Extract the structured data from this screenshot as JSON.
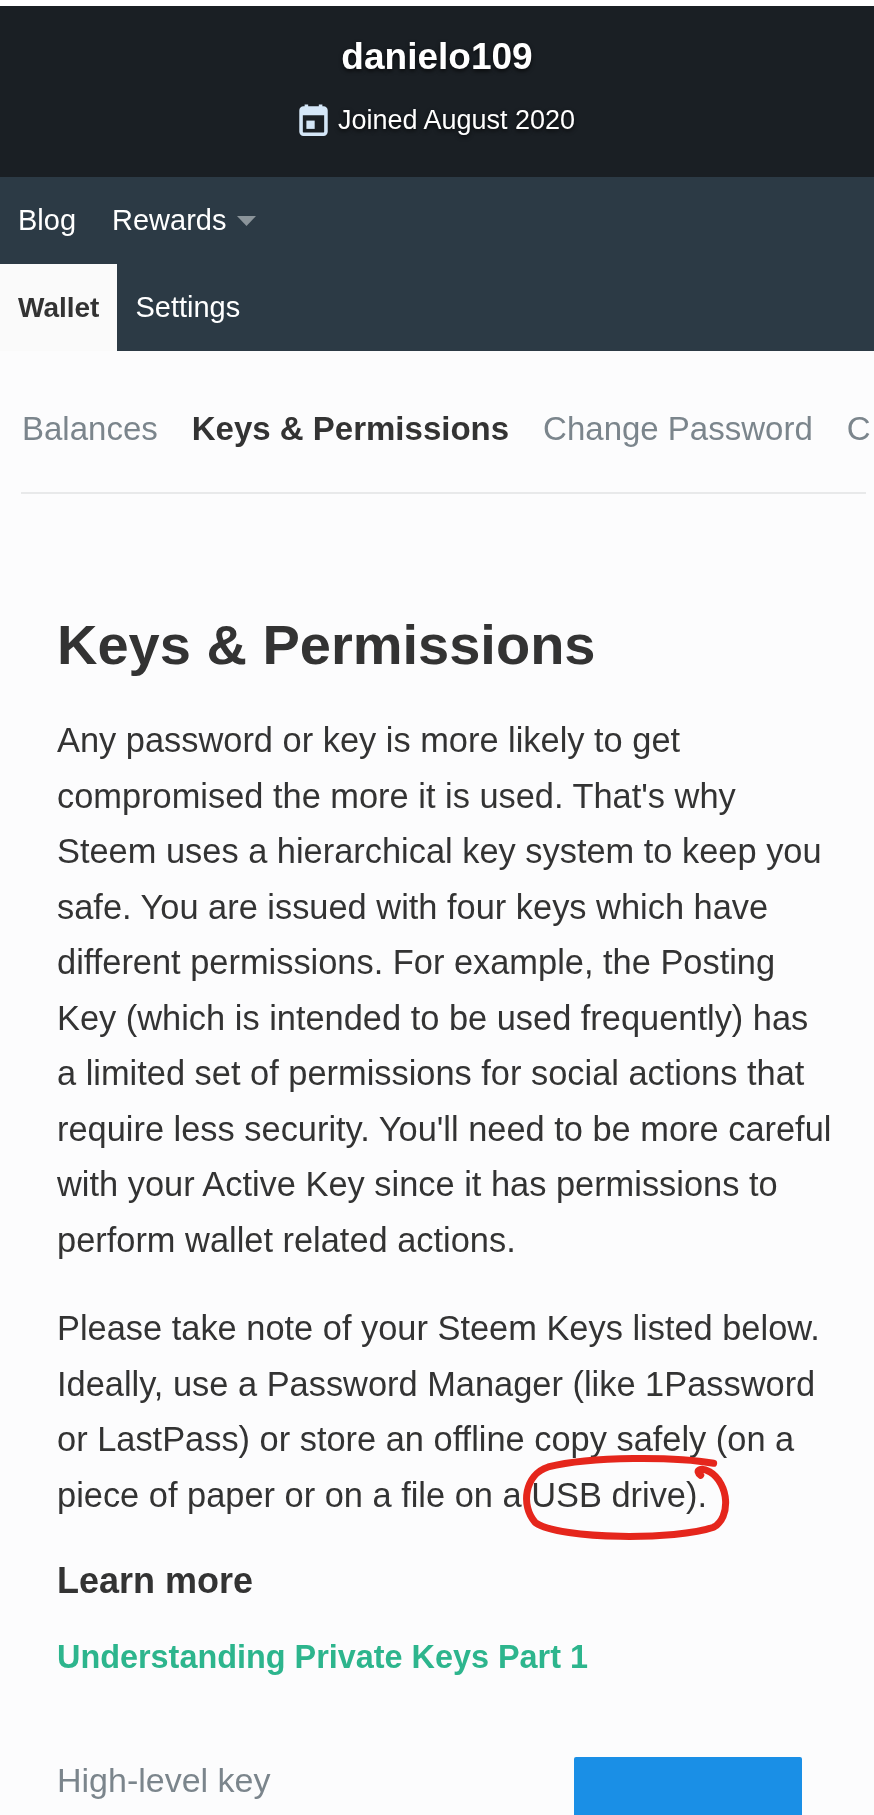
{
  "profile": {
    "username": "danielo109",
    "joined": "Joined August 2020"
  },
  "main_nav": [
    {
      "items": [
        {
          "label": "Blog",
          "selected": false,
          "dropdown": false
        },
        {
          "label": "Rewards",
          "selected": false,
          "dropdown": true
        }
      ]
    },
    {
      "items": [
        {
          "label": "Wallet",
          "selected": true,
          "dropdown": false
        },
        {
          "label": "Settings",
          "selected": false,
          "dropdown": false
        }
      ]
    }
  ],
  "wallet_tabs": [
    {
      "label": "Balances",
      "selected": false
    },
    {
      "label": "Keys & Permissions",
      "selected": true
    },
    {
      "label": "Change Password",
      "selected": false
    },
    {
      "label": "C",
      "selected": false
    }
  ],
  "page": {
    "title": "Keys & Permissions",
    "paragraphs": [
      {
        "parts": [
          {
            "text": "Any password or key is more likely to get compromised the more it is used. That's why Steem uses a hierarchical key system to keep you safe. You are issued with four keys which have different permissions. For example, the Posting Key (which is intended to be used frequently) has a limited set of permissions for social actions that require less security. You'll need to be more careful with your Active Key since it has permissions to perform wallet related actions."
          }
        ]
      },
      {
        "parts": [
          {
            "text": "Please take note of your Steem Keys listed below. Ideally, use a Password Manager (like 1Password or LastPass) or store an offline copy safely (on a piece of paper or on a file on a "
          },
          {
            "text": "USB drive",
            "circled": true
          },
          {
            "text": ")."
          }
        ]
      }
    ],
    "learn_more": {
      "heading": "Learn more",
      "links": [
        "Understanding Private Keys Part 1"
      ]
    },
    "key_section": {
      "label": "High-level key"
    }
  }
}
